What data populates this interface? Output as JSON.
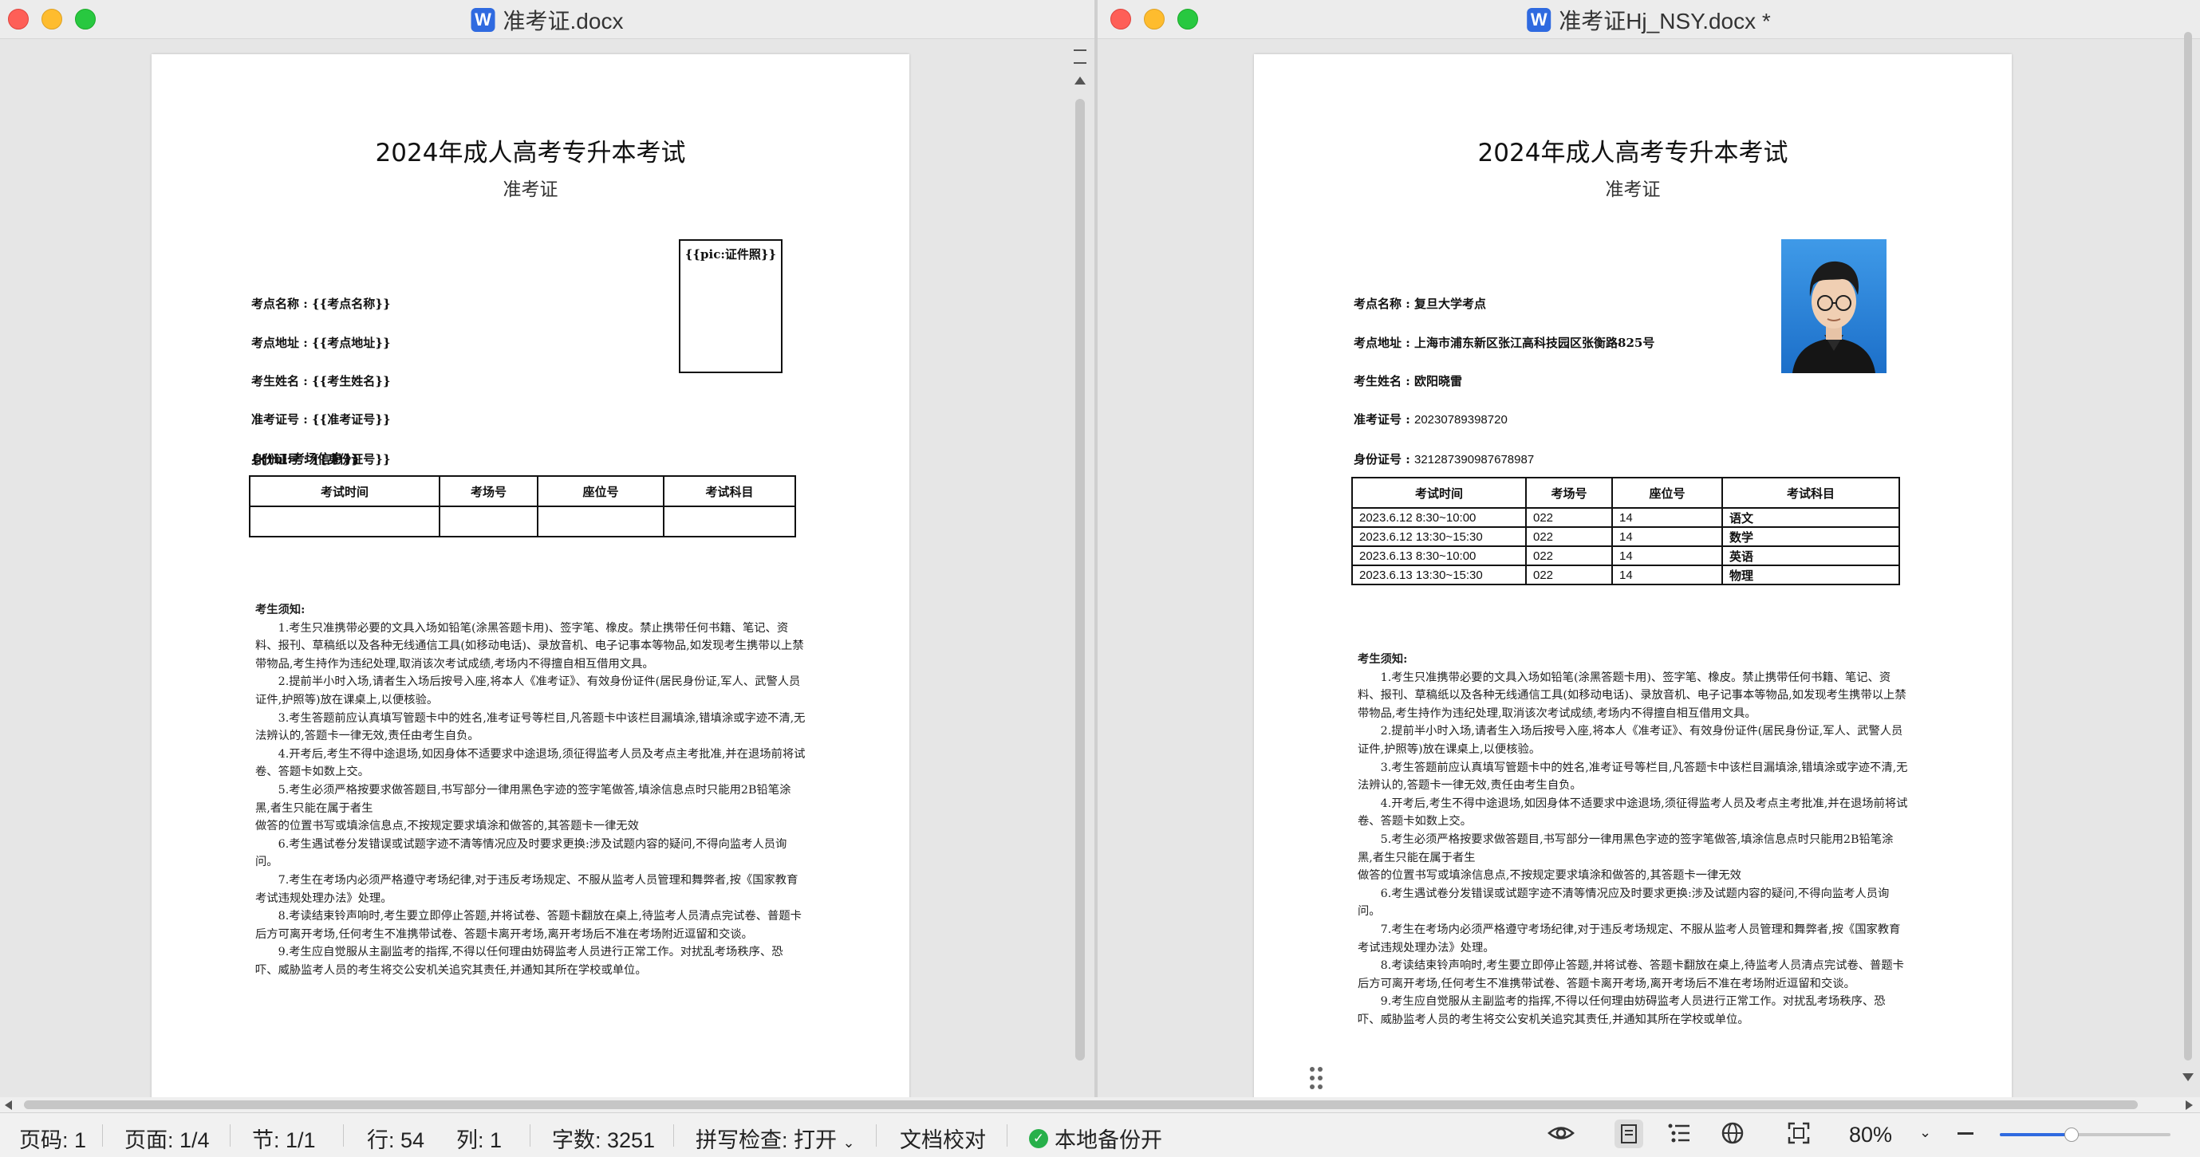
{
  "left_window": {
    "title": "准考证.docx",
    "app_icon": "W",
    "doc": {
      "title": "2024年成人高考专升本考试",
      "subtitle": "准考证",
      "fields": [
        {
          "label": "考点名称",
          "value": "{{考点名称}}"
        },
        {
          "label": "考点地址",
          "value": "{{考点地址}}"
        },
        {
          "label": "考生姓名",
          "value": "{{考生姓名}}"
        },
        {
          "label": "准考证号",
          "value": "{{准考证号}}"
        },
        {
          "label": "身份证号",
          "value": "{{身份证号}}"
        }
      ],
      "photo_placeholder": "{{pic:证件照}}",
      "table_placeholder": "{{tbl:考场信息}}",
      "table_headers": [
        "考试时间",
        "考场号",
        "座位号",
        "考试科目"
      ]
    }
  },
  "right_window": {
    "title": "准考证Hj_NSY.docx *",
    "app_icon": "W",
    "doc": {
      "title": "2024年成人高考专升本考试",
      "subtitle": "准考证",
      "fields": [
        {
          "label": "考点名称",
          "value": "复旦大学考点"
        },
        {
          "label": "考点地址",
          "value": "上海市浦东新区张江高科技园区张衡路825号"
        },
        {
          "label": "考生姓名",
          "value": "欧阳晓雷"
        },
        {
          "label": "准考证号",
          "value": "20230789398720"
        },
        {
          "label": "身份证号",
          "value": "321287390987678987"
        }
      ],
      "table_headers": [
        "考试时间",
        "考场号",
        "座位号",
        "考试科目"
      ],
      "table_rows": [
        [
          "2023.6.12   8:30~10:00",
          "022",
          "14",
          "语文"
        ],
        [
          "2023.6.12   13:30~15:30",
          "022",
          "14",
          "数学"
        ],
        [
          "2023.6.13   8:30~10:00",
          "022",
          "14",
          "英语"
        ],
        [
          "2023.6.13   13:30~15:30",
          "022",
          "14",
          "物理"
        ]
      ]
    }
  },
  "notice": {
    "heading": "考生须知:",
    "items": [
      "1.考生只准携带必要的文具入场如铅笔(涂黑答题卡用)、签字笔、橡皮。禁止携带任何书籍、笔记、资料、报刊、草稿纸以及各种无线通信工具(如移动电话)、录放音机、电子记事本等物品,如发现考生携带以上禁带物品,考生持作为违纪处理,取消该次考试成绩,考场内不得擅自相互借用文具。",
      "2.提前半小时入场,请者生入场后按号入座,将本人《准考证》、有效身份证件(居民身份证,军人、武警人员证件,护照等)放在课桌上,以便核验。",
      "3.考生答题前应认真填写管题卡中的姓名,准考证号等栏目,凡答题卡中该栏目漏填涂,错填涂或字迹不清,无法辨认的,答题卡一律无效,责任由考生自负。",
      "4.开考后,考生不得中途退场,如因身体不适要求中途退场,须征得监考人员及考点主考批准,并在退场前将试卷、答题卡如数上交。",
      "5.考生必须严格按要求做答题目,书写部分一律用黑色字迹的签字笔做答,填涂信息点时只能用2B铅笔涂黑,者生只能在属于者生",
      "做答的位置书写或填涂信息点,不按规定要求填涂和做答的,其答题卡一律无效",
      "6.考生遇试卷分发错误或试题字迹不清等情况应及时要求更换:涉及试题内容的疑问,不得向监考人员询问。",
      "7.考生在考场内必须严格遵守考场纪律,对于违反考场规定、不服从监考人员管理和舞弊者,按《国家教育考试违规处理办法》处理。",
      "8.考读结束铃声响时,考生要立即停止答题,并将试卷、答题卡翻放在桌上,待监考人员清点完试卷、普题卡后方可离开考场,任何考生不准携带试卷、答题卡离开考场,离开考场后不准在考场附近逗留和交谈。",
      "9.考生应自觉服从主副监考的指挥,不得以任何理由妨碍监考人员进行正常工作。对扰乱考场秩序、恐吓、威胁监考人员的考生将交公安机关追究其责任,并通知其所在学校或单位。"
    ]
  },
  "statusbar": {
    "page_code": "页码: 1",
    "page": "页面: 1/4",
    "section": "节: 1/1",
    "row": "行: 54",
    "col": "列: 1",
    "word_count": "字数: 3251",
    "spell_check": "拼写检查: 打开",
    "doc_proof": "文档校对",
    "local_backup": "本地备份开",
    "zoom": "80%",
    "zoom_level": 0.8
  },
  "colors": {
    "accent": "#2f6ae0",
    "backup_green": "#27b04a",
    "traffic_red": "#fe5f57",
    "traffic_yellow": "#febc2e",
    "traffic_green": "#28c840"
  }
}
